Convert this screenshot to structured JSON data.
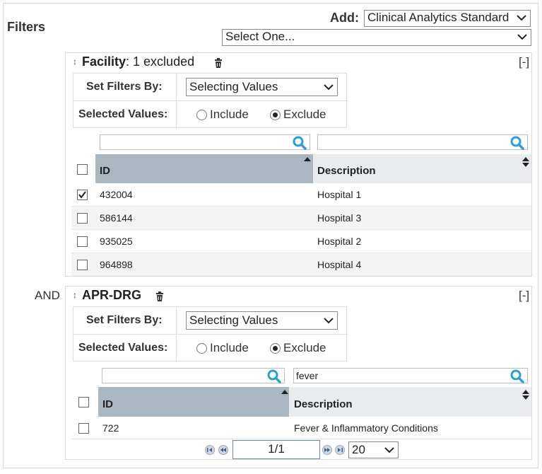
{
  "filters_label": "Filters",
  "add": {
    "label": "Add:",
    "selected": "Clinical Analytics Standard"
  },
  "select_one": {
    "selected": "Select One..."
  },
  "and_label": "AND",
  "facility": {
    "title": "Facility",
    "subtitle": ": 1 excluded",
    "collapse": "[-]",
    "set_filters_label": "Set Filters By:",
    "set_filters_value": "Selecting Values",
    "selected_values_label": "Selected Values:",
    "include_label": "Include",
    "exclude_label": "Exclude",
    "mode": "exclude",
    "search_id": "",
    "search_desc": "",
    "columns": {
      "id": "ID",
      "description": "Description"
    },
    "rows": [
      {
        "id": "432004",
        "desc": "Hospital 1",
        "checked": true
      },
      {
        "id": "586144",
        "desc": "Hospital 3",
        "checked": false
      },
      {
        "id": "935025",
        "desc": "Hospital 2",
        "checked": false
      },
      {
        "id": "964898",
        "desc": "Hospital 4",
        "checked": false
      }
    ]
  },
  "aprdrg": {
    "title": "APR-DRG",
    "collapse": "[-]",
    "set_filters_label": "Set Filters By:",
    "set_filters_value": "Selecting Values",
    "selected_values_label": "Selected Values:",
    "include_label": "Include",
    "exclude_label": "Exclude",
    "mode": "exclude",
    "search_id": "",
    "search_desc": "fever",
    "columns": {
      "id": "ID",
      "description": "Description"
    },
    "rows": [
      {
        "id": "722",
        "desc": "Fever & Inflammatory Conditions",
        "checked": false
      }
    ],
    "pager": {
      "page": "1/1",
      "page_size": "20"
    }
  },
  "colors": {
    "header_sorted": "#aab7c0",
    "header_plain": "#e9ecee",
    "search_icon": "#2a9fd6",
    "page_input_border": "#5b87c7"
  }
}
